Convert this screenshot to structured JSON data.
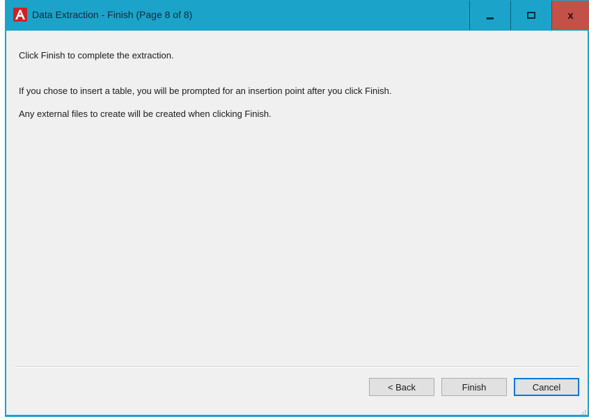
{
  "window": {
    "title": "Data Extraction - Finish (Page 8 of 8)",
    "icon": "autocad-a-icon",
    "controls": {
      "minimize": "minimize-icon",
      "maximize": "maximize-icon",
      "close": "x"
    }
  },
  "content": {
    "line1": "Click Finish to complete the extraction.",
    "line2": "If you chose to insert a table, you will be prompted for an insertion point after you click Finish.",
    "line3": "Any external files to create will be created when clicking Finish."
  },
  "buttons": {
    "back": "< Back",
    "finish": "Finish",
    "cancel": "Cancel"
  },
  "colors": {
    "titlebar": "#1ba3c9",
    "close_button": "#c4504a",
    "app_icon": "#d21f26",
    "background": "#f0f0f0"
  }
}
